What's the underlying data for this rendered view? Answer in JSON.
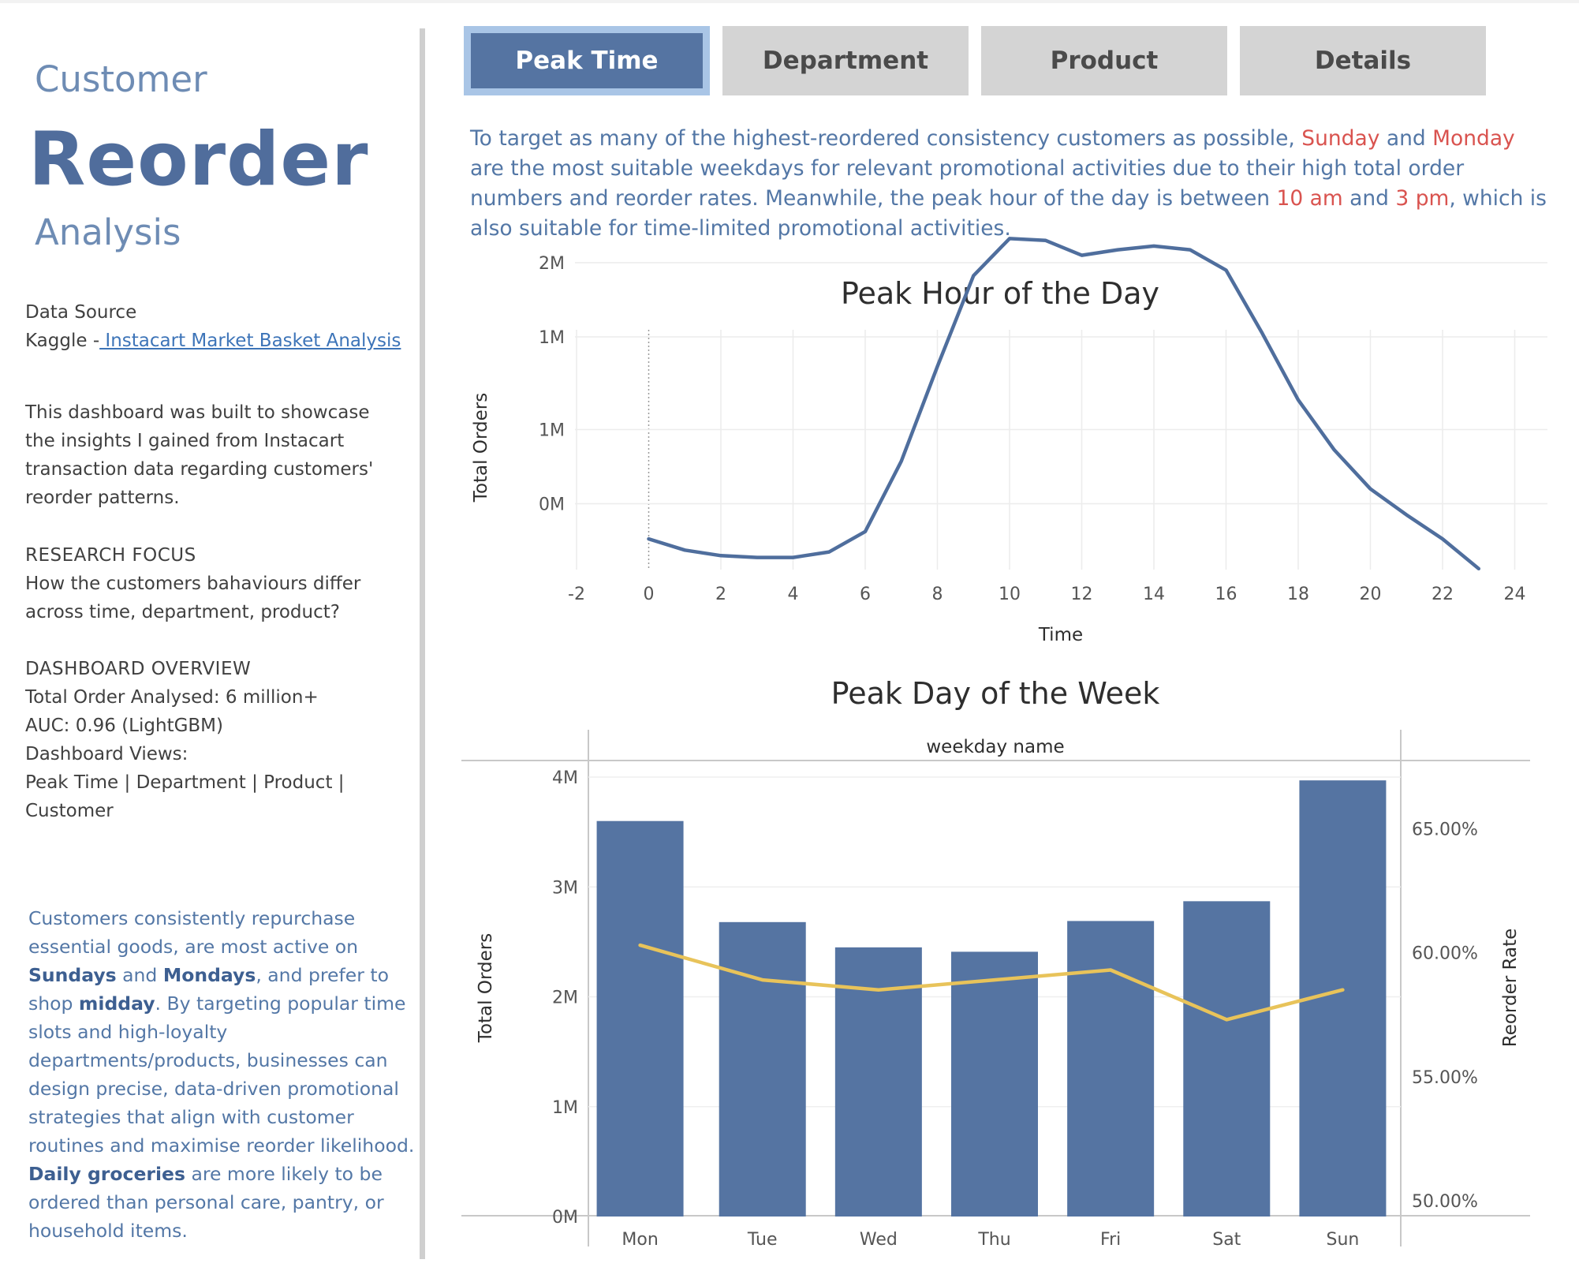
{
  "sidebar": {
    "title_line1": "Customer",
    "title_line2": "Reorder",
    "title_line3": "Analysis",
    "data_source_label": "Data Source",
    "data_source_prefix": "Kaggle -",
    "data_source_link": " Instacart Market Basket Analysis",
    "description": "This dashboard was built to showcase the insights I gained from Instacart transaction data regarding customers' reorder patterns.",
    "research_focus_heading": "RESEARCH FOCUS",
    "research_focus_text": "How the customers bahaviours differ across time, department, product?",
    "overview_heading": "DASHBOARD OVERVIEW",
    "overview_total": "Total Order Analysed: 6 million+",
    "overview_auc": "AUC: 0.96 (LightGBM)",
    "overview_views_label": "Dashboard Views:",
    "overview_views": "Peak Time | Department | Product | Customer",
    "insight": {
      "p1": "Customers consistently repurchase essential goods, are most active on ",
      "b1": "Sundays",
      "p2": " and ",
      "b2": "Mondays",
      "p3": ", and prefer to shop ",
      "b3": "midday",
      "p4": ". By targeting popular time slots and high-loyalty departments/products, businesses can design precise, data-driven promotional strategies that align with customer routines and maximise reorder likelihood. ",
      "b4": "Daily groceries",
      "p5": " are more likely to be ordered than personal care, pantry, or household items."
    }
  },
  "tabs": [
    {
      "label": "Peak Time",
      "active": true
    },
    {
      "label": "Department",
      "active": false
    },
    {
      "label": "Product",
      "active": false
    },
    {
      "label": "Details",
      "active": false
    }
  ],
  "intro": {
    "p1": "To target as many of the highest-reordered consistency customers as possible, ",
    "r1": "Sunday",
    "p2": " and ",
    "r2": "Monday",
    "p3": " are the most suitable weekdays for relevant promotional activities due to their high total order numbers and reorder rates. Meanwhile, the peak hour of the day is between ",
    "r3": "10 am",
    "p4": " and ",
    "r4": "3 pm",
    "p5": ", which is also suitable for time-limited promotional activities."
  },
  "colors": {
    "bar": "#5574a2",
    "line": "#4f6e9d",
    "reorder_line": "#e8c35a",
    "highlight_red": "#d9534f",
    "accent_blue": "#5377a6"
  },
  "chart_data": [
    {
      "type": "line",
      "title": "Peak Hour of the Day",
      "xlabel": "Time",
      "ylabel": "Total Orders",
      "x_ticks": [
        "-2",
        "0",
        "2",
        "4",
        "6",
        "8",
        "10",
        "12",
        "14",
        "16",
        "18",
        "20",
        "22",
        "24"
      ],
      "y_ticks": [
        "0M",
        "1M",
        "1M",
        "2M"
      ],
      "xlim": [
        -2,
        24
      ],
      "ylim": [
        0,
        2.1
      ],
      "grid": true,
      "x": [
        0,
        1,
        2,
        3,
        4,
        5,
        6,
        7,
        8,
        9,
        10,
        11,
        12,
        13,
        14,
        15,
        16,
        17,
        18,
        19,
        20,
        21,
        22,
        23
      ],
      "values": [
        0.11,
        0.05,
        0.02,
        0.01,
        0.01,
        0.04,
        0.15,
        0.53,
        1.04,
        1.53,
        1.73,
        1.72,
        1.64,
        1.67,
        1.69,
        1.67,
        1.56,
        1.22,
        0.86,
        0.59,
        0.38,
        0.24,
        0.11,
        -0.05
      ]
    },
    {
      "type": "bar",
      "title": "Peak Day of the Week",
      "header": "weekday name",
      "ylabel": "Total Orders",
      "y2label": "Reorder Rate",
      "categories": [
        "Mon",
        "Tue",
        "Wed",
        "Thu",
        "Fri",
        "Sat",
        "Sun"
      ],
      "y_ticks": [
        "0M",
        "1M",
        "2M",
        "3M",
        "4M"
      ],
      "y2_ticks": [
        "50.00%",
        "55.00%",
        "60.00%",
        "65.00%"
      ],
      "ylim": [
        0,
        4
      ],
      "y2lim": [
        50,
        67
      ],
      "series": [
        {
          "values": [
            3.6,
            2.68,
            2.45,
            2.41,
            2.69,
            2.87,
            3.97
          ]
        },
        {
          "values": [
            60.3,
            58.9,
            58.5,
            58.9,
            59.3,
            57.3,
            58.5
          ]
        }
      ]
    }
  ]
}
